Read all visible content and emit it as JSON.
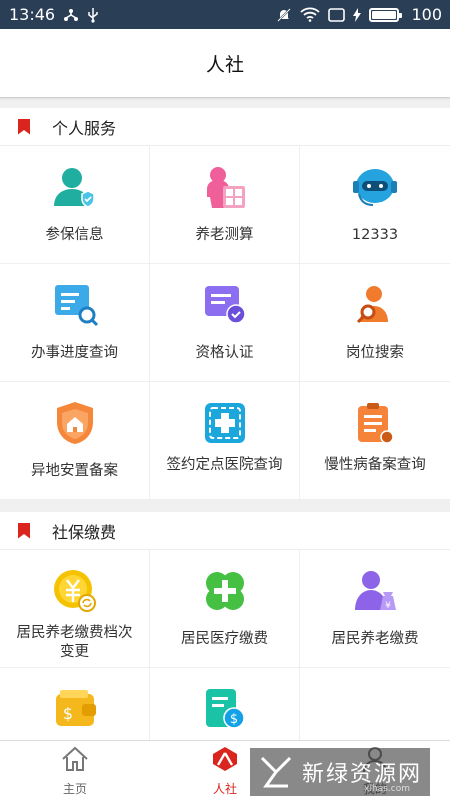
{
  "status_bar": {
    "time": "13:46",
    "battery": "100",
    "icons": [
      "fork-icon",
      "usb-icon",
      "mute-icon",
      "wifi-icon",
      "tablet-icon",
      "charging-icon",
      "battery-icon"
    ]
  },
  "header": {
    "title": "人社"
  },
  "sections": [
    {
      "title": "个人服务",
      "items": [
        {
          "label": "参保信息",
          "icon": "insured-person-icon"
        },
        {
          "label": "养老测算",
          "icon": "pension-calculator-icon"
        },
        {
          "label": "12333",
          "icon": "hotline-robot-icon"
        },
        {
          "label": "办事进度查询",
          "icon": "progress-search-icon"
        },
        {
          "label": "资格认证",
          "icon": "certification-icon"
        },
        {
          "label": "岗位搜索",
          "icon": "job-search-icon"
        },
        {
          "label": "异地安置备案",
          "icon": "relocation-shield-icon"
        },
        {
          "label": "签约定点医院查询",
          "icon": "hospital-icon"
        },
        {
          "label": "慢性病备案查询",
          "icon": "chronic-disease-icon"
        }
      ]
    },
    {
      "title": "社保缴费",
      "items": [
        {
          "label": "居民养老缴费档次变更",
          "icon": "yuan-coin-icon"
        },
        {
          "label": "居民医疗缴费",
          "icon": "medical-cross-icon"
        },
        {
          "label": "居民养老缴费",
          "icon": "elder-payment-icon"
        },
        {
          "label": "",
          "icon": "wallet-icon"
        },
        {
          "label": "",
          "icon": "bill-icon"
        }
      ]
    }
  ],
  "tabbar": [
    {
      "label": "主页",
      "icon": "home-icon"
    },
    {
      "label": "人社",
      "icon": "renshe-logo-icon"
    },
    {
      "label": "我的",
      "icon": "profile-icon"
    }
  ],
  "watermark": {
    "text": "新绿资源网",
    "sub": "xlhas.com"
  },
  "colors": {
    "accent": "#d9251d",
    "statusbar": "#2a3f56"
  }
}
